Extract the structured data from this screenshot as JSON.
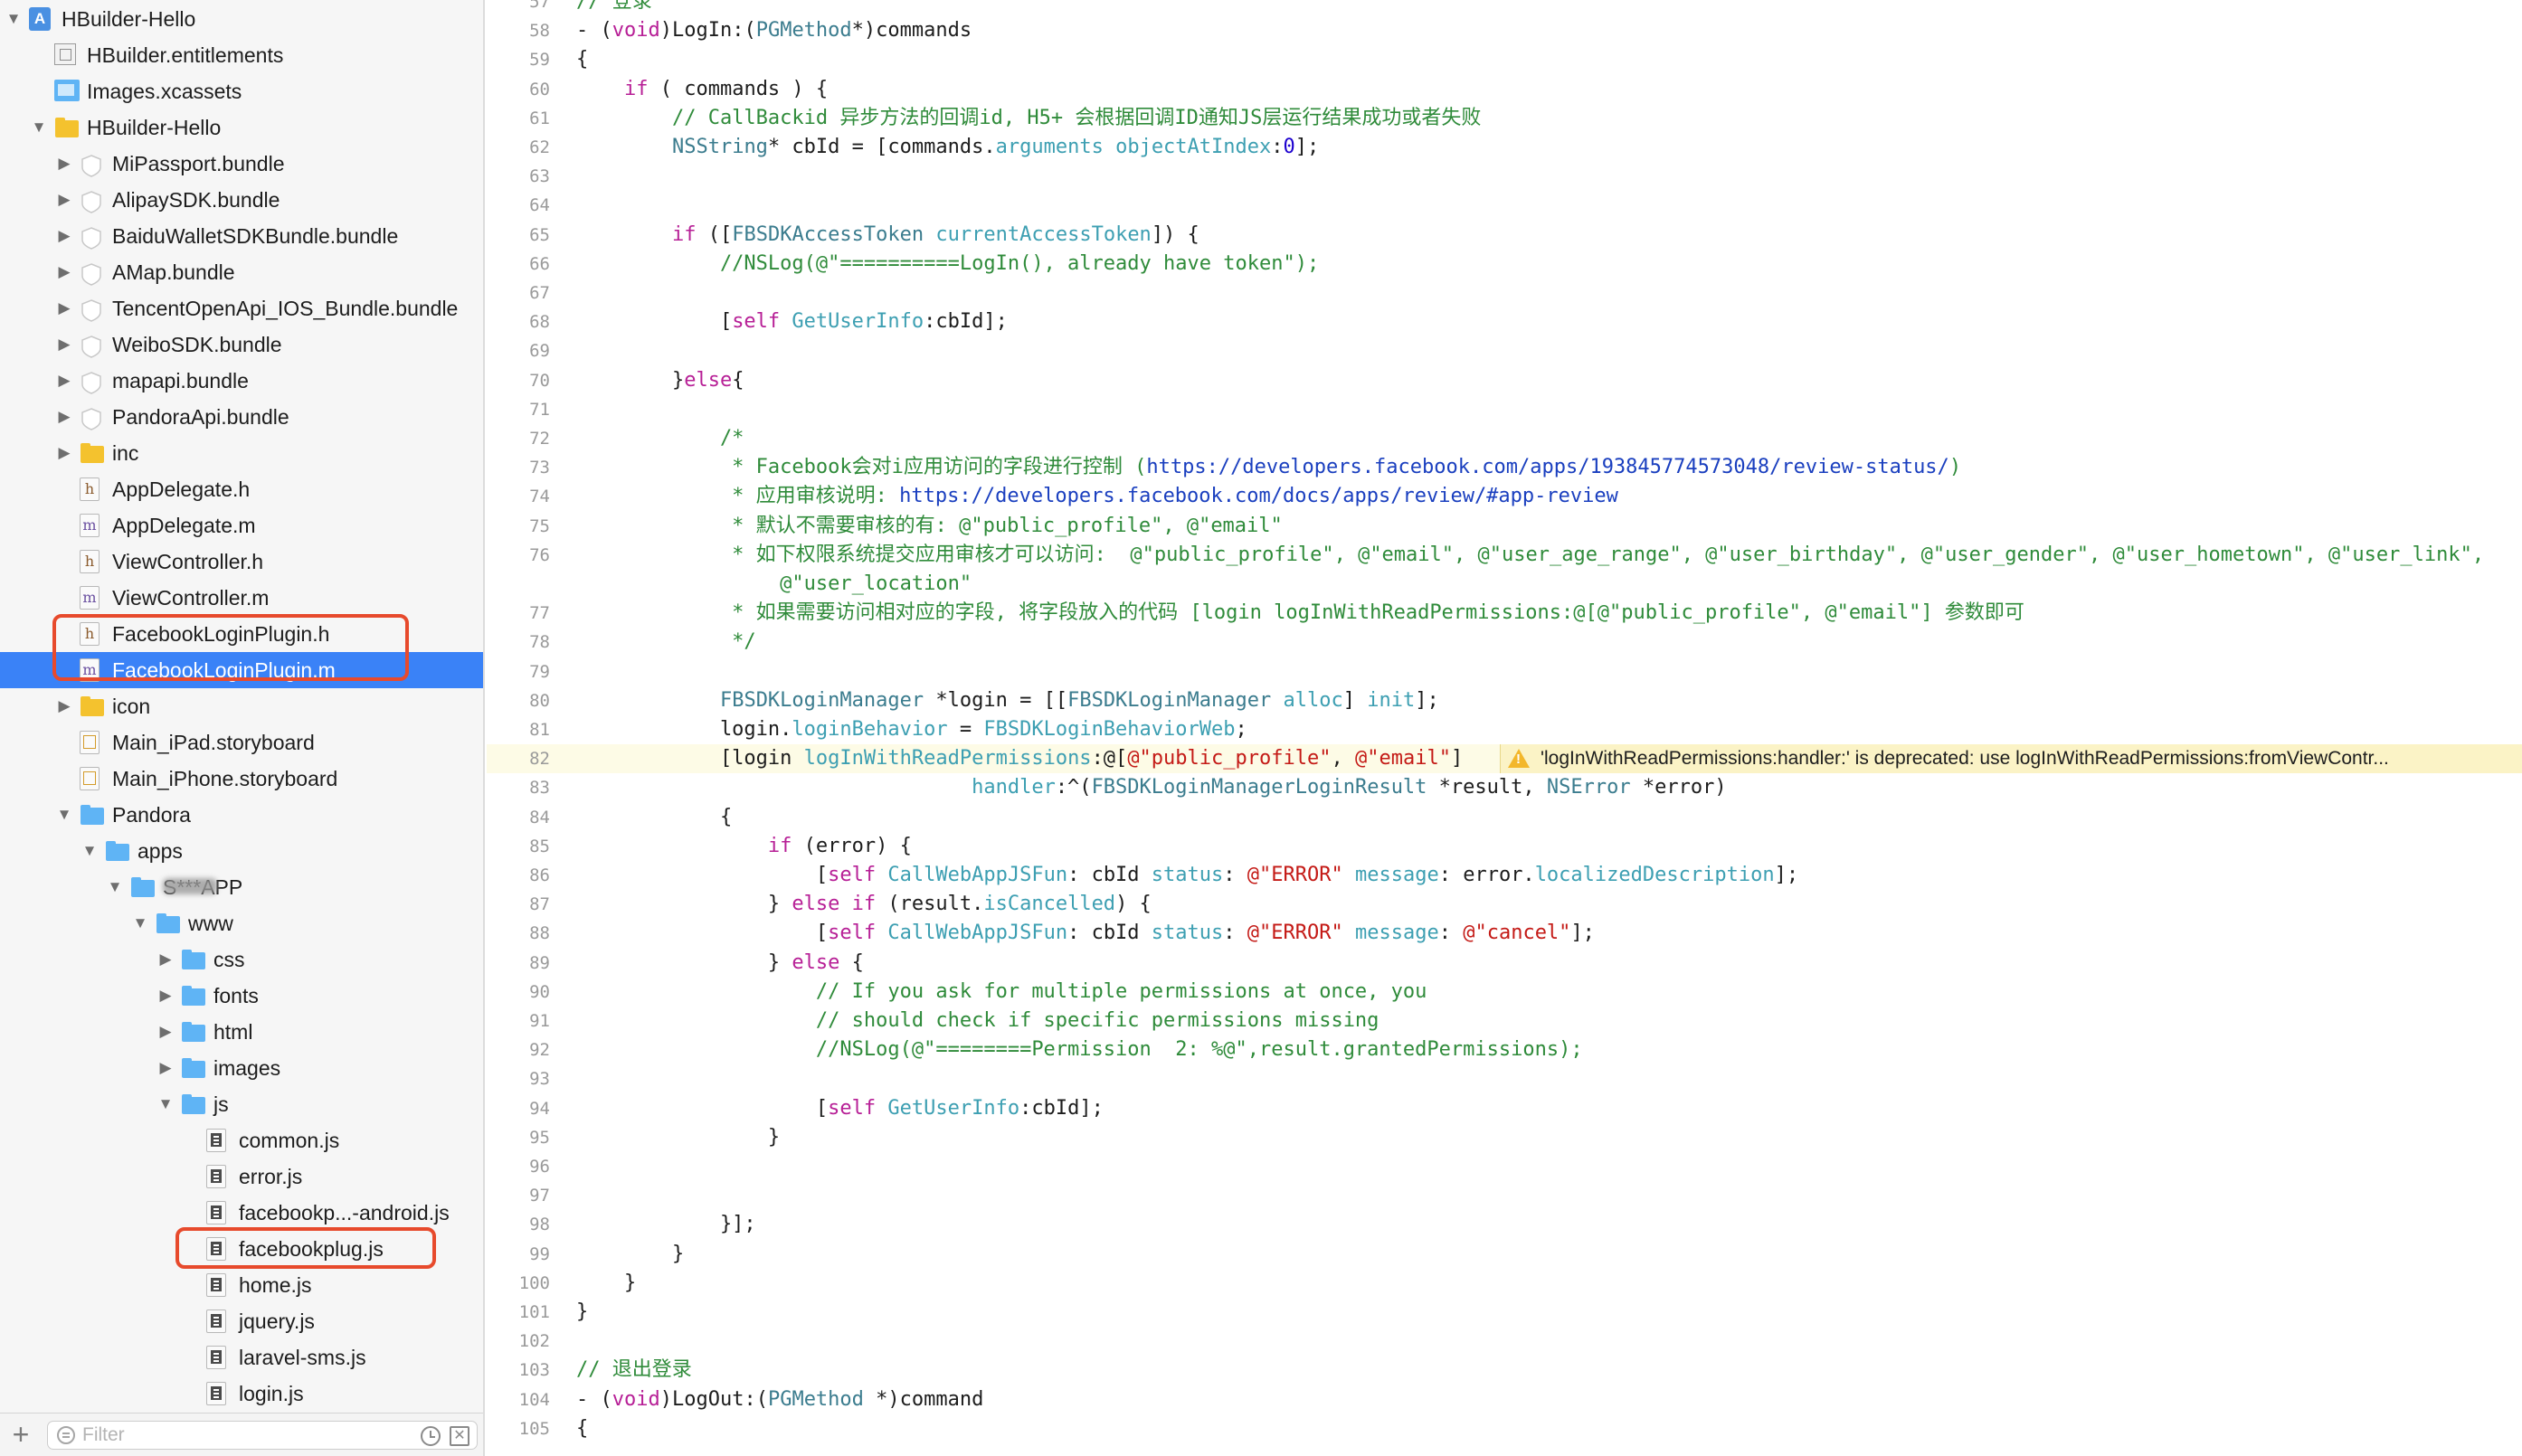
{
  "navigator": {
    "items": [
      {
        "label": "HBuilder-Hello",
        "depth": 0,
        "icon": "project",
        "disclosure": "open"
      },
      {
        "label": "HBuilder.entitlements",
        "depth": 1,
        "icon": "entitlements",
        "disclosure": "none"
      },
      {
        "label": "Images.xcassets",
        "depth": 1,
        "icon": "xcassets",
        "disclosure": "none"
      },
      {
        "label": "HBuilder-Hello",
        "depth": 1,
        "icon": "folder-yellow",
        "disclosure": "open"
      },
      {
        "label": "MiPassport.bundle",
        "depth": 2,
        "icon": "bundle",
        "disclosure": "closed"
      },
      {
        "label": "AlipaySDK.bundle",
        "depth": 2,
        "icon": "bundle",
        "disclosure": "closed"
      },
      {
        "label": "BaiduWalletSDKBundle.bundle",
        "depth": 2,
        "icon": "bundle",
        "disclosure": "closed"
      },
      {
        "label": "AMap.bundle",
        "depth": 2,
        "icon": "bundle",
        "disclosure": "closed"
      },
      {
        "label": "TencentOpenApi_IOS_Bundle.bundle",
        "depth": 2,
        "icon": "bundle",
        "disclosure": "closed"
      },
      {
        "label": "WeiboSDK.bundle",
        "depth": 2,
        "icon": "bundle",
        "disclosure": "closed"
      },
      {
        "label": "mapapi.bundle",
        "depth": 2,
        "icon": "bundle",
        "disclosure": "closed"
      },
      {
        "label": "PandoraApi.bundle",
        "depth": 2,
        "icon": "bundle",
        "disclosure": "closed"
      },
      {
        "label": "inc",
        "depth": 2,
        "icon": "folder-yellow",
        "disclosure": "closed"
      },
      {
        "label": "AppDelegate.h",
        "depth": 2,
        "icon": "h",
        "disclosure": "none"
      },
      {
        "label": "AppDelegate.m",
        "depth": 2,
        "icon": "m",
        "disclosure": "none"
      },
      {
        "label": "ViewController.h",
        "depth": 2,
        "icon": "h",
        "disclosure": "none"
      },
      {
        "label": "ViewController.m",
        "depth": 2,
        "icon": "m",
        "disclosure": "none"
      },
      {
        "label": "FacebookLoginPlugin.h",
        "depth": 2,
        "icon": "h",
        "disclosure": "none"
      },
      {
        "label": "FacebookLoginPlugin.m",
        "depth": 2,
        "icon": "m",
        "disclosure": "none",
        "selected": true
      },
      {
        "label": "icon",
        "depth": 2,
        "icon": "folder-yellow",
        "disclosure": "closed"
      },
      {
        "label": "Main_iPad.storyboard",
        "depth": 2,
        "icon": "storyboard",
        "disclosure": "none"
      },
      {
        "label": "Main_iPhone.storyboard",
        "depth": 2,
        "icon": "storyboard",
        "disclosure": "none"
      },
      {
        "label": "Pandora",
        "depth": 2,
        "icon": "folder-blue",
        "disclosure": "open"
      },
      {
        "label": "apps",
        "depth": 3,
        "icon": "folder-blue",
        "disclosure": "open"
      },
      {
        "label": "S***APP",
        "depth": 4,
        "icon": "folder-blue",
        "disclosure": "open",
        "redacted": true
      },
      {
        "label": "www",
        "depth": 5,
        "icon": "folder-blue",
        "disclosure": "open"
      },
      {
        "label": "css",
        "depth": 6,
        "icon": "folder-blue",
        "disclosure": "closed"
      },
      {
        "label": "fonts",
        "depth": 6,
        "icon": "folder-blue",
        "disclosure": "closed"
      },
      {
        "label": "html",
        "depth": 6,
        "icon": "folder-blue",
        "disclosure": "closed"
      },
      {
        "label": "images",
        "depth": 6,
        "icon": "folder-blue",
        "disclosure": "closed"
      },
      {
        "label": "js",
        "depth": 6,
        "icon": "folder-blue",
        "disclosure": "open"
      },
      {
        "label": "common.js",
        "depth": 7,
        "icon": "js",
        "disclosure": "none"
      },
      {
        "label": "error.js",
        "depth": 7,
        "icon": "js",
        "disclosure": "none"
      },
      {
        "label": "facebookp...-android.js",
        "depth": 7,
        "icon": "js",
        "disclosure": "none"
      },
      {
        "label": "facebookplug.js",
        "depth": 7,
        "icon": "js",
        "disclosure": "none"
      },
      {
        "label": "home.js",
        "depth": 7,
        "icon": "js",
        "disclosure": "none"
      },
      {
        "label": "jquery.js",
        "depth": 7,
        "icon": "js",
        "disclosure": "none"
      },
      {
        "label": "laravel-sms.js",
        "depth": 7,
        "icon": "js",
        "disclosure": "none"
      },
      {
        "label": "login.js",
        "depth": 7,
        "icon": "js",
        "disclosure": "none"
      }
    ],
    "filter": {
      "add_label": "+",
      "placeholder": "Filter",
      "value": ""
    }
  },
  "colors": {
    "selection": "#3a82f7",
    "highlight_box": "#e74a2c",
    "keyword": "#b71f96",
    "comment": "#2f8b3a",
    "string": "#c41a16",
    "warning_bg": "#fbf3c6"
  },
  "editor": {
    "current_line": 82,
    "warning": {
      "line": 82,
      "icon": "warning-triangle-icon",
      "text": "'logInWithReadPermissions:handler:' is deprecated: use logInWithReadPermissions:fromViewContr..."
    },
    "lines": [
      {
        "n": "57",
        "tokens": [
          [
            "c",
            "// 登录"
          ]
        ]
      },
      {
        "n": "58",
        "tokens": [
          [
            "p",
            "- ("
          ],
          [
            "k",
            "void"
          ],
          [
            "p",
            ")LogIn:("
          ],
          [
            "t",
            "PGMethod"
          ],
          [
            "p",
            "*)commands"
          ]
        ]
      },
      {
        "n": "59",
        "tokens": [
          [
            "p",
            "{"
          ]
        ]
      },
      {
        "n": "60",
        "tokens": [
          [
            "p",
            "    "
          ],
          [
            "k",
            "if"
          ],
          [
            "p",
            " ( commands ) {"
          ]
        ]
      },
      {
        "n": "61",
        "tokens": [
          [
            "c",
            "        // CallBackid 异步方法的回调id, H5+ 会根据回调ID通知JS层运行结果成功或者失败"
          ]
        ]
      },
      {
        "n": "62",
        "tokens": [
          [
            "p",
            "        "
          ],
          [
            "t",
            "NSString"
          ],
          [
            "p",
            "* cbId = [commands."
          ],
          [
            "f",
            "arguments"
          ],
          [
            "p",
            " "
          ],
          [
            "f",
            "objectAtIndex"
          ],
          [
            "p",
            ":"
          ],
          [
            "n",
            "0"
          ],
          [
            "p",
            "];"
          ]
        ]
      },
      {
        "n": "63",
        "tokens": []
      },
      {
        "n": "64",
        "tokens": []
      },
      {
        "n": "65",
        "tokens": [
          [
            "p",
            "        "
          ],
          [
            "k",
            "if"
          ],
          [
            "p",
            " (["
          ],
          [
            "t",
            "FBSDKAccessToken"
          ],
          [
            "p",
            " "
          ],
          [
            "f",
            "currentAccessToken"
          ],
          [
            "p",
            "]) {"
          ]
        ]
      },
      {
        "n": "66",
        "tokens": [
          [
            "c",
            "            //NSLog(@\"==========LogIn(), already have token\");"
          ]
        ]
      },
      {
        "n": "67",
        "tokens": []
      },
      {
        "n": "68",
        "tokens": [
          [
            "p",
            "            ["
          ],
          [
            "k",
            "self"
          ],
          [
            "p",
            " "
          ],
          [
            "f",
            "GetUserInfo"
          ],
          [
            "p",
            ":cbId];"
          ]
        ]
      },
      {
        "n": "69",
        "tokens": []
      },
      {
        "n": "70",
        "tokens": [
          [
            "p",
            "        }"
          ],
          [
            "k",
            "else"
          ],
          [
            "p",
            "{"
          ]
        ]
      },
      {
        "n": "71",
        "tokens": []
      },
      {
        "n": "72",
        "tokens": [
          [
            "c",
            "            /*"
          ]
        ]
      },
      {
        "n": "73",
        "tokens": [
          [
            "c",
            "             * Facebook会对i应用访问的字段进行控制 ("
          ],
          [
            "u",
            "https://developers.facebook.com/apps/193845774573048/review-status/"
          ],
          [
            "c",
            ")"
          ]
        ]
      },
      {
        "n": "74",
        "tokens": [
          [
            "c",
            "             * 应用审核说明: "
          ],
          [
            "u",
            "https://developers.facebook.com/docs/apps/review/#app-review"
          ]
        ]
      },
      {
        "n": "75",
        "tokens": [
          [
            "c",
            "             * 默认不需要审核的有: @\"public_profile\", @\"email\""
          ]
        ]
      },
      {
        "n": "76",
        "tokens": [
          [
            "c",
            "             * 如下权限系统提交应用审核才可以访问:  @\"public_profile\", @\"email\", @\"user_age_range\", @\"user_birthday\", @\"user_gender\", @\"user_hometown\", @\"user_link\","
          ]
        ]
      },
      {
        "n": "",
        "tokens": [
          [
            "c",
            "                 @\"user_location\""
          ]
        ]
      },
      {
        "n": "77",
        "tokens": [
          [
            "c",
            "             * 如果需要访问相对应的字段, 将字段放入的代码 [login logInWithReadPermissions:@[@\"public_profile\", @\"email\"] 参数即可"
          ]
        ]
      },
      {
        "n": "78",
        "tokens": [
          [
            "c",
            "             */"
          ]
        ]
      },
      {
        "n": "79",
        "tokens": []
      },
      {
        "n": "80",
        "tokens": [
          [
            "p",
            "            "
          ],
          [
            "t",
            "FBSDKLoginManager"
          ],
          [
            "p",
            " *login = [["
          ],
          [
            "t",
            "FBSDKLoginManager"
          ],
          [
            "p",
            " "
          ],
          [
            "f",
            "alloc"
          ],
          [
            "p",
            "] "
          ],
          [
            "f",
            "init"
          ],
          [
            "p",
            "];"
          ]
        ]
      },
      {
        "n": "81",
        "tokens": [
          [
            "p",
            "            login."
          ],
          [
            "f",
            "loginBehavior"
          ],
          [
            "p",
            " = "
          ],
          [
            "f",
            "FBSDKLoginBehaviorWeb"
          ],
          [
            "p",
            ";"
          ]
        ]
      },
      {
        "n": "82",
        "tokens": [
          [
            "p",
            "            [login "
          ],
          [
            "f",
            "logInWithReadPermissions"
          ],
          [
            "p",
            ":@["
          ],
          [
            "s",
            "@\"public_profile\""
          ],
          [
            "p",
            ", "
          ],
          [
            "s",
            "@\"email\""
          ],
          [
            "p",
            "]"
          ]
        ]
      },
      {
        "n": "83",
        "tokens": [
          [
            "p",
            "                                 "
          ],
          [
            "f",
            "handler"
          ],
          [
            "p",
            ":^("
          ],
          [
            "t",
            "FBSDKLoginManagerLoginResult"
          ],
          [
            "p",
            " *result, "
          ],
          [
            "t",
            "NSError"
          ],
          [
            "p",
            " *error)"
          ]
        ]
      },
      {
        "n": "84",
        "tokens": [
          [
            "p",
            "            {"
          ]
        ]
      },
      {
        "n": "85",
        "tokens": [
          [
            "p",
            "                "
          ],
          [
            "k",
            "if"
          ],
          [
            "p",
            " (error) {"
          ]
        ]
      },
      {
        "n": "86",
        "tokens": [
          [
            "p",
            "                    ["
          ],
          [
            "k",
            "self"
          ],
          [
            "p",
            " "
          ],
          [
            "f",
            "CallWebAppJSFun"
          ],
          [
            "p",
            ": cbId "
          ],
          [
            "f",
            "status"
          ],
          [
            "p",
            ": "
          ],
          [
            "s",
            "@\"ERROR\""
          ],
          [
            "p",
            " "
          ],
          [
            "f",
            "message"
          ],
          [
            "p",
            ": error."
          ],
          [
            "f",
            "localizedDescription"
          ],
          [
            "p",
            "];"
          ]
        ]
      },
      {
        "n": "87",
        "tokens": [
          [
            "p",
            "                } "
          ],
          [
            "k",
            "else if"
          ],
          [
            "p",
            " (result."
          ],
          [
            "f",
            "isCancelled"
          ],
          [
            "p",
            ") {"
          ]
        ]
      },
      {
        "n": "88",
        "tokens": [
          [
            "p",
            "                    ["
          ],
          [
            "k",
            "self"
          ],
          [
            "p",
            " "
          ],
          [
            "f",
            "CallWebAppJSFun"
          ],
          [
            "p",
            ": cbId "
          ],
          [
            "f",
            "status"
          ],
          [
            "p",
            ": "
          ],
          [
            "s",
            "@\"ERROR\""
          ],
          [
            "p",
            " "
          ],
          [
            "f",
            "message"
          ],
          [
            "p",
            ": "
          ],
          [
            "s",
            "@\"cancel\""
          ],
          [
            "p",
            "];"
          ]
        ]
      },
      {
        "n": "89",
        "tokens": [
          [
            "p",
            "                } "
          ],
          [
            "k",
            "else"
          ],
          [
            "p",
            " {"
          ]
        ]
      },
      {
        "n": "90",
        "tokens": [
          [
            "c",
            "                    // If you ask for multiple permissions at once, you"
          ]
        ]
      },
      {
        "n": "91",
        "tokens": [
          [
            "c",
            "                    // should check if specific permissions missing"
          ]
        ]
      },
      {
        "n": "92",
        "tokens": [
          [
            "c",
            "                    //NSLog(@\"========Permission  2: %@\",result.grantedPermissions);"
          ]
        ]
      },
      {
        "n": "93",
        "tokens": []
      },
      {
        "n": "94",
        "tokens": [
          [
            "p",
            "                    ["
          ],
          [
            "k",
            "self"
          ],
          [
            "p",
            " "
          ],
          [
            "f",
            "GetUserInfo"
          ],
          [
            "p",
            ":cbId];"
          ]
        ]
      },
      {
        "n": "95",
        "tokens": [
          [
            "p",
            "                }"
          ]
        ]
      },
      {
        "n": "96",
        "tokens": []
      },
      {
        "n": "97",
        "tokens": []
      },
      {
        "n": "98",
        "tokens": [
          [
            "p",
            "            }];"
          ]
        ]
      },
      {
        "n": "99",
        "tokens": [
          [
            "p",
            "        }"
          ]
        ]
      },
      {
        "n": "100",
        "tokens": [
          [
            "p",
            "    }"
          ]
        ]
      },
      {
        "n": "101",
        "tokens": [
          [
            "p",
            "}"
          ]
        ]
      },
      {
        "n": "102",
        "tokens": []
      },
      {
        "n": "103",
        "tokens": [
          [
            "c",
            "// 退出登录"
          ]
        ]
      },
      {
        "n": "104",
        "tokens": [
          [
            "p",
            "- ("
          ],
          [
            "k",
            "void"
          ],
          [
            "p",
            ")LogOut:("
          ],
          [
            "t",
            "PGMethod"
          ],
          [
            "p",
            " *)command"
          ]
        ]
      },
      {
        "n": "105",
        "tokens": [
          [
            "p",
            "{"
          ]
        ]
      }
    ]
  }
}
